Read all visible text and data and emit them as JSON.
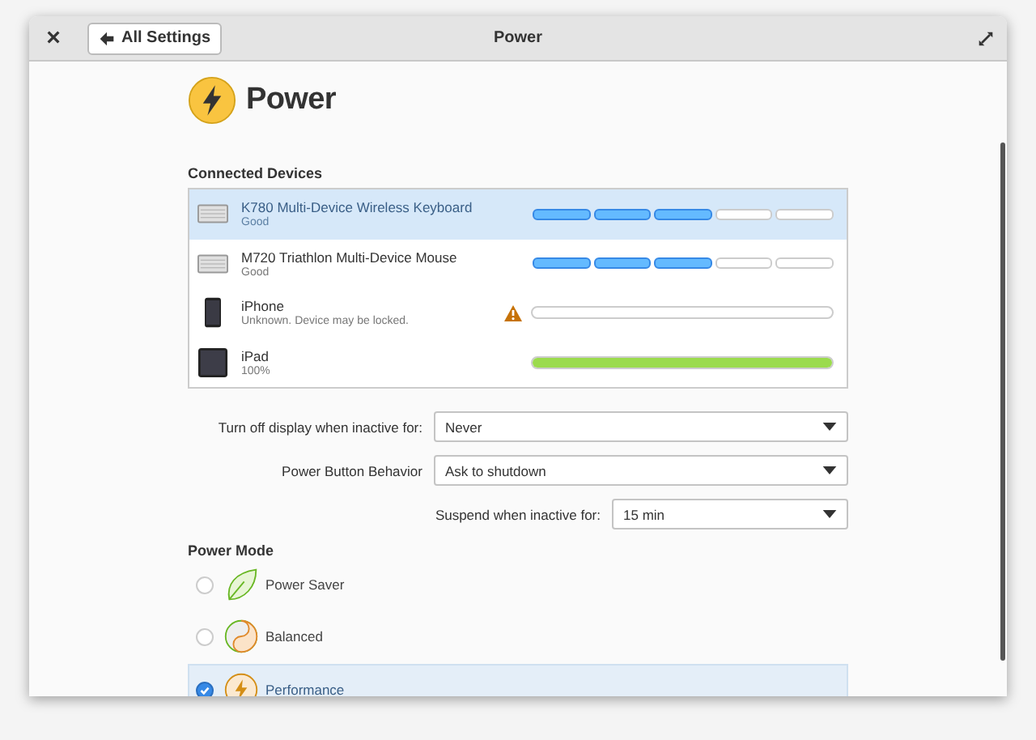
{
  "window": {
    "title": "Power",
    "back_button": "All Settings",
    "close": "×"
  },
  "header": {
    "title": "Power"
  },
  "connected_devices": {
    "heading": "Connected Devices",
    "devices": [
      {
        "kind": "keyboard",
        "name": "K780 Multi-Device Wireless Keyboard",
        "status": "Good",
        "selected": true,
        "battery": {
          "kind": "segments",
          "level": 0.6
        },
        "warning": false
      },
      {
        "kind": "keyboard",
        "name": "M720 Triathlon Multi-Device Mouse",
        "status": "Good",
        "selected": false,
        "battery": {
          "kind": "segments",
          "level": 0.6
        },
        "warning": false
      },
      {
        "kind": "phone",
        "name": "iPhone",
        "status": "Unknown. Device may be locked.",
        "selected": false,
        "battery": {
          "kind": "continuous",
          "level": 0
        },
        "warning": true
      },
      {
        "kind": "tablet",
        "name": "iPad",
        "status": "100%",
        "selected": false,
        "battery": {
          "kind": "continuous",
          "level": 1
        },
        "warning": false
      }
    ]
  },
  "settings": [
    {
      "label": "Turn off display when inactive for:",
      "value": "Never"
    },
    {
      "label": "Power Button Behavior",
      "value": "Ask to shutdown"
    },
    {
      "label": "Suspend when inactive for:",
      "value": "15 min"
    }
  ],
  "power_mode": {
    "heading": "Power Mode",
    "modes": [
      {
        "kind": "saver",
        "label": "Power Saver",
        "selected": false
      },
      {
        "kind": "balanced",
        "label": "Balanced",
        "selected": false
      },
      {
        "kind": "performance",
        "label": "Performance",
        "selected": true
      }
    ]
  }
}
